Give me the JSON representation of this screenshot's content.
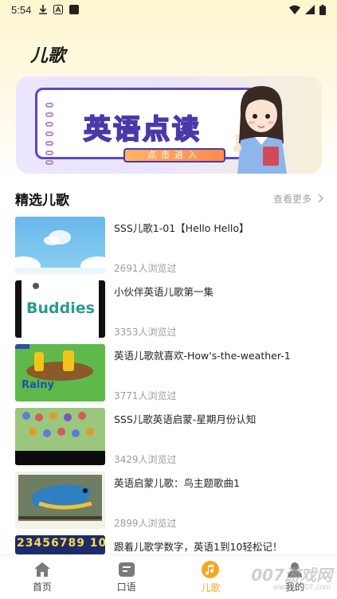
{
  "status_bar": {
    "time": "5:54",
    "icons": [
      "download-icon",
      "font-icon",
      "app-square-icon",
      "wifi-icon",
      "signal-icon",
      "battery-icon"
    ]
  },
  "page": {
    "title": "儿歌"
  },
  "banner": {
    "headline": "英语点读",
    "button_label": "点击进入"
  },
  "section": {
    "title": "精选儿歌",
    "see_more": "查看更多",
    "see_more_icon": "chevron-right-icon"
  },
  "songs": [
    {
      "title": "SSS儿歌1-01【Hello Hello】",
      "views": "2691人浏览过"
    },
    {
      "title": "小伙伴英语儿歌第一集",
      "views": "3353人浏览过",
      "thumb_text": "Buddies"
    },
    {
      "title": "英语儿歌就喜欢-How's-the-weather-1",
      "views": "3771人浏览过",
      "thumb_text": "Rainy"
    },
    {
      "title": "SSS儿歌英语启蒙-星期月份认知",
      "views": "3429人浏览过"
    },
    {
      "title": "英语启蒙儿歌：鸟主题歌曲1",
      "views": "2899人浏览过"
    },
    {
      "title": "跟着儿歌学数字，英语1到10轻松记！",
      "views": "",
      "thumb_text": "23456789 10"
    }
  ],
  "bottom_nav": [
    {
      "label": "首页",
      "icon": "home-icon",
      "active": false
    },
    {
      "label": "口语",
      "icon": "speech-icon",
      "active": false
    },
    {
      "label": "儿歌",
      "icon": "music-note-icon",
      "active": true
    },
    {
      "label": "我的",
      "icon": "profile-icon",
      "active": false
    }
  ],
  "watermark": {
    "text": "007游戏网",
    "sub": "www.yx007.com"
  },
  "colors": {
    "accent": "#f5a623",
    "banner_purple": "#5b47c6"
  }
}
